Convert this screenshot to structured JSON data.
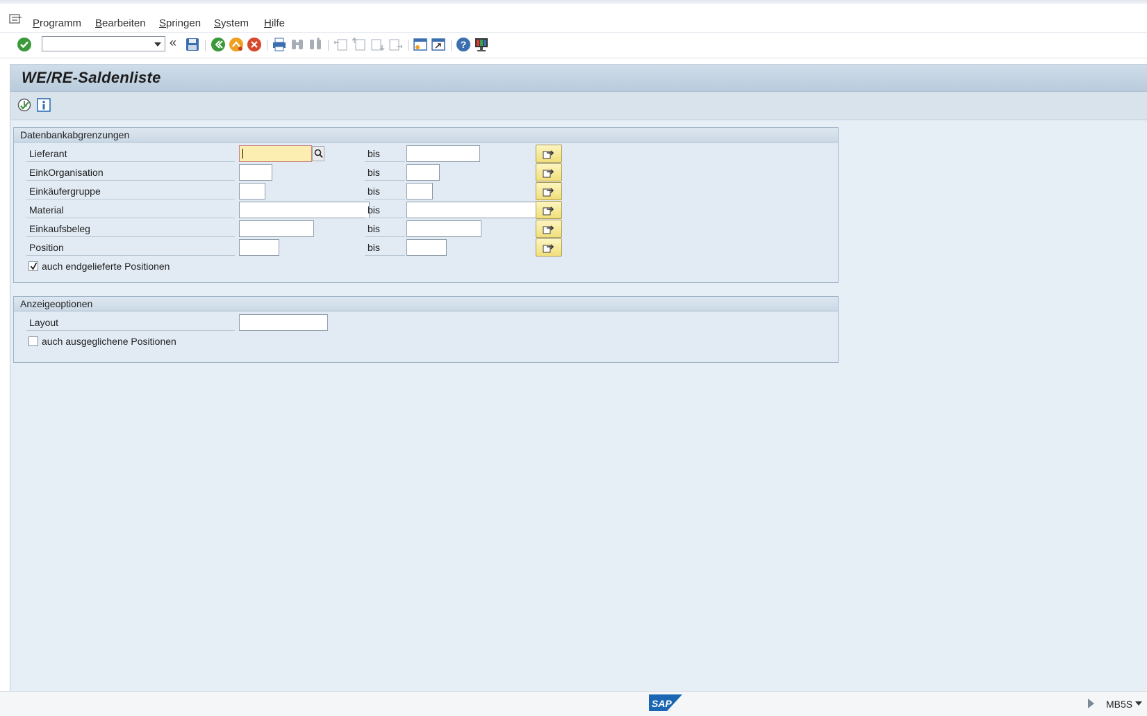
{
  "menubar": {
    "items": [
      {
        "label": "Programm",
        "mnemonic": "P",
        "rest": "rogramm"
      },
      {
        "label": "Bearbeiten",
        "mnemonic": "B",
        "rest": "earbeiten"
      },
      {
        "label": "Springen",
        "mnemonic": "S",
        "rest": "pringen"
      },
      {
        "label": "System",
        "mnemonic": "S",
        "rest": "ystem"
      },
      {
        "label": "Hilfe",
        "mnemonic": "H",
        "rest": "ilfe"
      }
    ]
  },
  "toolbar": {
    "command_field": "",
    "icons": [
      "enter-icon",
      "command-field",
      "collapse-icon",
      "save-icon",
      "back-icon",
      "exit-icon",
      "cancel-icon",
      "print-icon",
      "find-icon",
      "find-next-icon",
      "first-page-icon",
      "previous-page-icon",
      "next-page-icon",
      "last-page-icon",
      "create-session-icon",
      "shortcut-icon",
      "help-icon",
      "customize-layout-icon"
    ]
  },
  "page": {
    "title": "WE/RE-Saldenliste"
  },
  "db_group": {
    "title": "Datenbankabgrenzungen",
    "bis_label": "bis",
    "rows": [
      {
        "label": "Lieferant",
        "low": "",
        "high": ""
      },
      {
        "label": "EinkOrganisation",
        "low": "",
        "high": ""
      },
      {
        "label": "Einkäufergruppe",
        "low": "",
        "high": ""
      },
      {
        "label": "Material",
        "low": "",
        "high": ""
      },
      {
        "label": "Einkaufsbeleg",
        "low": "",
        "high": ""
      },
      {
        "label": "Position",
        "low": "",
        "high": ""
      }
    ],
    "checkbox": {
      "label": "auch endgelieferte Positionen",
      "checked": true
    }
  },
  "display_group": {
    "title": "Anzeigeoptionen",
    "layout_label": "Layout",
    "layout_value": "",
    "checkbox": {
      "label": "auch ausgeglichene Positionen",
      "checked": false
    }
  },
  "statusbar": {
    "logo_text": "SAP",
    "tcode": "MB5S"
  },
  "colors": {
    "accent_green": "#3a9a3a",
    "active_field": "#fbeeb0",
    "multi_button": "#f1df7a",
    "sap_blue": "#1b66b2"
  }
}
